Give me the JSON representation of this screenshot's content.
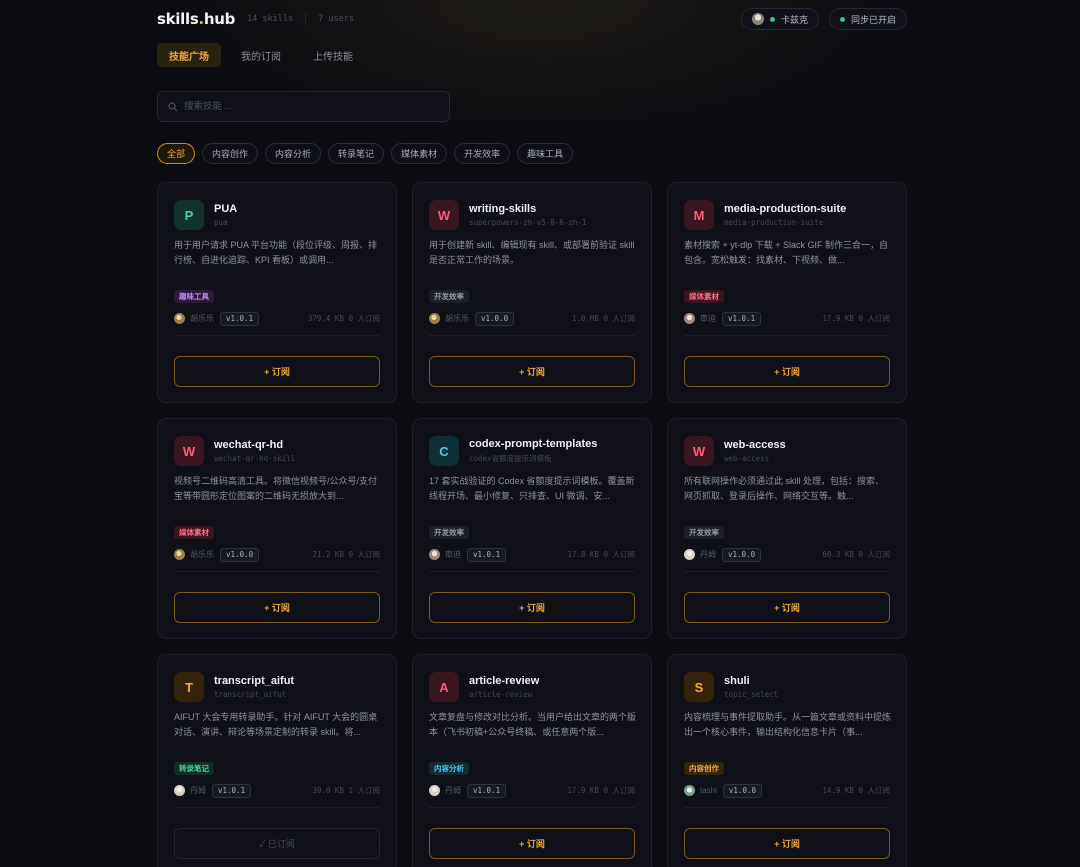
{
  "header": {
    "logo_main": "skills",
    "logo_dot": ".",
    "logo_tail": "hub",
    "skills_count": "14 skills",
    "separator": "|",
    "users_count": "7 users",
    "user_name": "卡兹克",
    "sync_status": "同步已开启"
  },
  "tabs": [
    "技能广场",
    "我的订阅",
    "上传技能"
  ],
  "search": {
    "placeholder": "搜索技能 ..."
  },
  "filters": [
    "全部",
    "内容创作",
    "内容分析",
    "转录笔记",
    "媒体素材",
    "开发效率",
    "趣味工具"
  ],
  "cards": [
    {
      "badge": "P",
      "title": "PUA",
      "slug": "pua",
      "desc": "用于用户请求 PUA 平台功能（段位评级、周报、排行榜、自进化追踪、KPI 看板）或调用...",
      "tag": "趣味工具",
      "author": "胡乐乐",
      "version": "v1.0.1",
      "stats": "379.4 KB  0 人订阅",
      "button": "+ 订阅"
    },
    {
      "badge": "W",
      "title": "writing-skills",
      "slug": "superpowers-zh-v5-0-6-zh-1",
      "desc": "用于创建新 skill、编辑现有 skill、或部署前验证 skill 是否正常工作的场景。",
      "tag": "开发效率",
      "author": "胡乐乐",
      "version": "v1.0.0",
      "stats": "1.0 MB  0 人订阅",
      "button": "+ 订阅"
    },
    {
      "badge": "M",
      "title": "media-production-suite",
      "slug": "media-production-suite",
      "desc": "素材搜索 + yt-dlp 下载 + Slack GIF 制作三合一，自包含。宽松触发：找素材、下视频、做...",
      "tag": "媒体素材",
      "author": "审迫",
      "version": "v1.0.1",
      "stats": "17.9 KB  0 人订阅",
      "button": "+ 订阅"
    },
    {
      "badge": "W",
      "title": "wechat-qr-hd",
      "slug": "wechat-qr-hd-skill",
      "desc": "视频号二维码高清工具。将微信视频号/公众号/支付宝等带圆形定位图案的二维码无损放大到...",
      "tag": "媒体素材",
      "author": "胡乐乐",
      "version": "v1.0.0",
      "stats": "21.2 KB  0 人订阅",
      "button": "+ 订阅"
    },
    {
      "badge": "C",
      "title": "codex-prompt-templates",
      "slug": "codex省额度提示词模板",
      "desc": "17 套实战验证的 Codex 省额度提示词模板。覆盖新线程开场、最小修复、只排查、UI 微调、安...",
      "tag": "开发效率",
      "author": "审迫",
      "version": "v1.0.1",
      "stats": "17.8 KB  0 人订阅",
      "button": "+ 订阅"
    },
    {
      "badge": "W",
      "title": "web-access",
      "slug": "web-access",
      "desc": "所有联网操作必须通过此 skill 处理，包括：搜索、网页抓取、登录后操作、网络交互等。触...",
      "tag": "开发效率",
      "author": "丹姆",
      "version": "v1.0.0",
      "stats": "60.3 KB  0 人订阅",
      "button": "+ 订阅"
    },
    {
      "badge": "T",
      "title": "transcript_aifut",
      "slug": "transcript_aifut",
      "desc": "AIFUT 大会专用转录助手。针对 AIFUT 大会的圆桌对话、演讲、辩论等场景定制的转录 skill。将...",
      "tag": "转录笔记",
      "author": "丹姆",
      "version": "v1.0.1",
      "stats": "39.0 KB  1 人订阅",
      "button": "✓ 已订阅",
      "subscribed": true
    },
    {
      "badge": "A",
      "title": "article-review",
      "slug": "article-review",
      "desc": "文章复盘与修改对比分析。当用户给出文章的两个版本（飞书初稿+公众号终稿、或任意两个版...",
      "tag": "内容分析",
      "author": "丹姆",
      "version": "v1.0.1",
      "stats": "17.9 KB  0 人订阅",
      "button": "+ 订阅"
    },
    {
      "badge": "S",
      "title": "shuli",
      "slug": "topic_select",
      "desc": "内容梳理与事件提取助手。从一篇文章或资料中提炼出一个核心事件，输出结构化信息卡片（事...",
      "tag": "内容创作",
      "author": "tashi",
      "version": "v1.0.0",
      "stats": "14.9 KB  0 人订阅",
      "button": "+ 订阅"
    }
  ],
  "colors": {
    "accent": "#f1a83a",
    "background": "#0b0c12",
    "card": "#0f1018",
    "online": "#36c97a"
  }
}
